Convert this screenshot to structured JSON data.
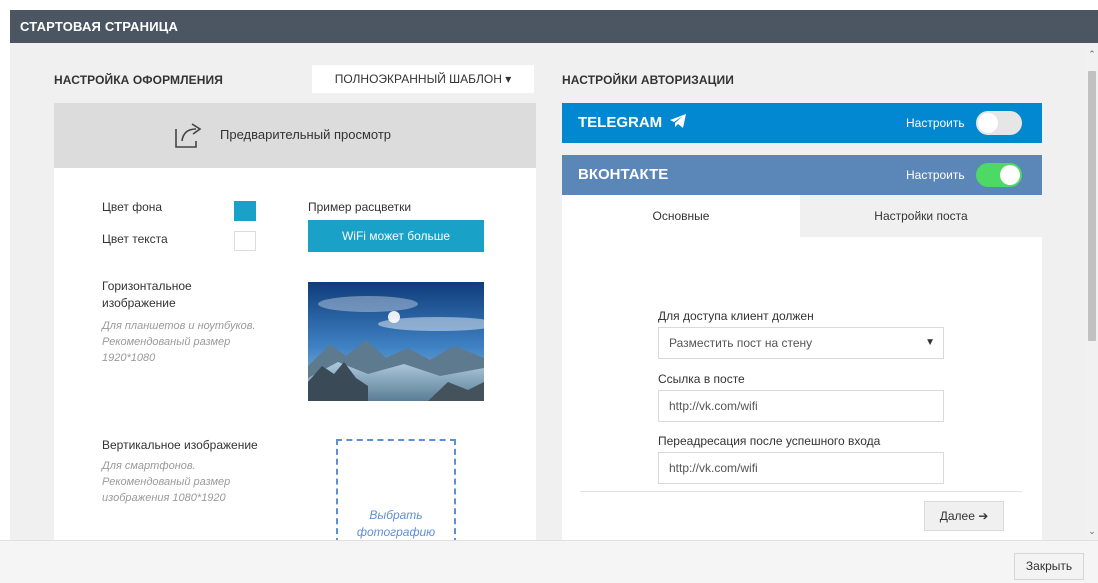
{
  "header": {
    "title": "СТАРТОВАЯ СТРАНИЦА"
  },
  "design": {
    "title": "НАСТРОЙКА ОФОРМЛЕНИЯ",
    "template": "ПОЛНОЭКРАННЫЙ ШАБЛОН ▾",
    "preview_label": "Предварительный просмотр",
    "bg_color_label": "Цвет фона",
    "text_color_label": "Цвет текста",
    "sample_label": "Пример расцветки",
    "sample_button": "WiFi может больше",
    "bg_color": "#1aa1c8",
    "text_color": "#ffffff",
    "horizontal": {
      "label_line1": "Горизонтальное",
      "label_line2": "изображение",
      "hint1": "Для планшетов и ноутбуков.",
      "hint2": "Рекомендованый размер",
      "hint3": "1920*1080"
    },
    "vertical": {
      "label": "Вертикальное изображение",
      "hint1": "Для смартфонов.",
      "hint2": "Рекомендованый размер",
      "hint3": "изображения 1080*1920",
      "choose_photo_line1": "Выбрать",
      "choose_photo_line2": "фотографию"
    }
  },
  "auth": {
    "title": "НАСТРОЙКИ АВТОРИЗАЦИИ",
    "telegram": {
      "name": "TELEGRAM",
      "setting": "Настроить",
      "enabled": false
    },
    "vk": {
      "name": "ВКОНТАКТЕ",
      "setting": "Настроить",
      "enabled": true
    },
    "tabs": [
      "Основные",
      "Настройки поста"
    ],
    "form": {
      "access_label": "Для доступа клиент должен",
      "access_value": "Разместить пост на стену",
      "link_label": "Ссылка в посте",
      "link_value": "http://vk.com/wifi",
      "redirect_label": "Переадресация после успешного входа",
      "redirect_value": "http://vk.com/wifi"
    },
    "next_button": "Далее ➔"
  },
  "footer": {
    "close_button": "Закрыть"
  },
  "scroll": {
    "up": "⌃",
    "down": "⌄"
  }
}
